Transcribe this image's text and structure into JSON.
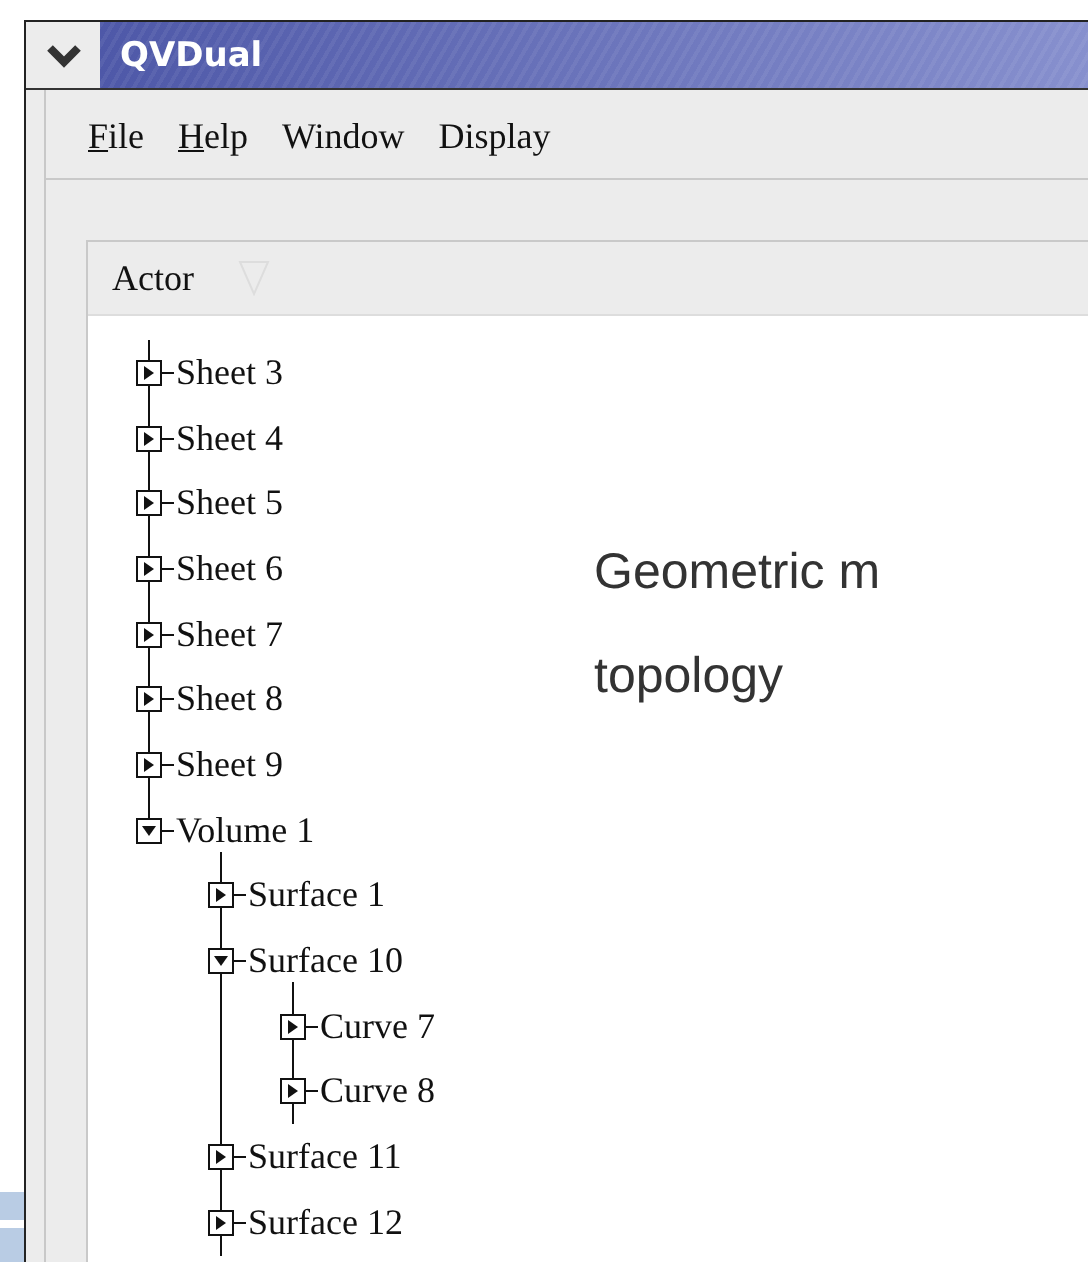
{
  "window": {
    "title": "QVDual"
  },
  "menu": [
    {
      "label": "File",
      "mnemonic_underlined": true
    },
    {
      "label": "Help",
      "mnemonic_underlined": true
    },
    {
      "label": "Window",
      "mnemonic_underlined": false
    },
    {
      "label": "Display",
      "mnemonic_underlined": false
    }
  ],
  "tree": {
    "columns": [
      "Actor"
    ],
    "items": [
      {
        "label": "Sheet 3",
        "expanded": false
      },
      {
        "label": "Sheet 4",
        "expanded": false
      },
      {
        "label": "Sheet 5",
        "expanded": false
      },
      {
        "label": "Sheet 6",
        "expanded": false
      },
      {
        "label": "Sheet 7",
        "expanded": false
      },
      {
        "label": "Sheet 8",
        "expanded": false
      },
      {
        "label": "Sheet 9",
        "expanded": false
      },
      {
        "label": "Volume 1",
        "expanded": true,
        "children": [
          {
            "label": "Surface 1",
            "expanded": false
          },
          {
            "label": "Surface 10",
            "expanded": true,
            "children": [
              {
                "label": "Curve 7",
                "expanded": false
              },
              {
                "label": "Curve 8",
                "expanded": false
              }
            ]
          },
          {
            "label": "Surface 11",
            "expanded": false
          },
          {
            "label": "Surface 12",
            "expanded": false
          }
        ]
      }
    ]
  },
  "overlay_text": [
    "Geometric m",
    "topology"
  ]
}
